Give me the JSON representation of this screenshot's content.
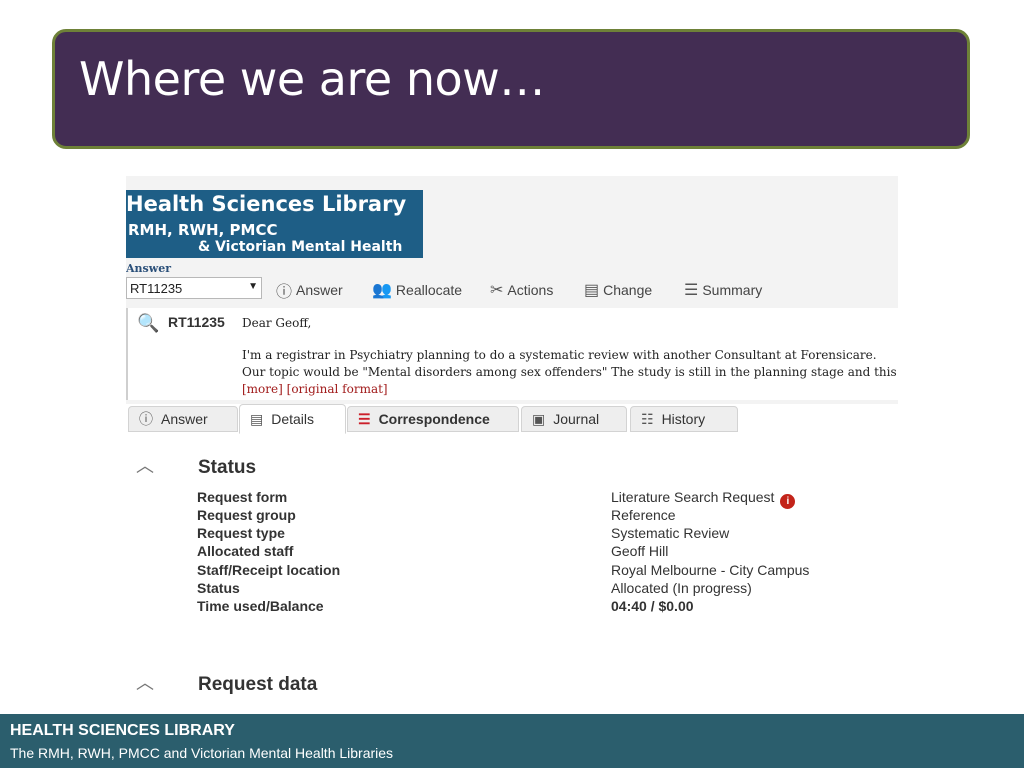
{
  "slide": {
    "title": "Where we are now…",
    "footer_title": "HEALTH SCIENCES LIBRARY",
    "footer_subtitle": "The RMH, RWH, PMCC and Victorian Mental Health Libraries"
  },
  "app": {
    "logo_line1": "Health Sciences Library",
    "logo_line2": "RMH, RWH, PMCC",
    "logo_line3": "& Victorian Mental Health",
    "answer_label": "Answer",
    "request_select": "RT11235",
    "toolbar": {
      "answer": "Answer",
      "reallocate": "Reallocate",
      "actions": "Actions",
      "change": "Change",
      "summary": "Summary"
    },
    "message": {
      "id": "RT11235",
      "greeting": "Dear Geoff,",
      "line1": "I'm a registrar in Psychiatry planning to do a systematic review with another Consultant at Forensicare.",
      "line2": "Our topic would be \"Mental disorders among sex offenders\" The study is still in the planning stage and this",
      "more_link": "[more]",
      "original_link": "[original format]"
    },
    "tabs": [
      "Answer",
      "Details",
      "Correspondence",
      "Journal",
      "History"
    ],
    "status": {
      "heading": "Status",
      "rows": [
        {
          "label": "Request form",
          "value": "Literature Search Request"
        },
        {
          "label": "Request group",
          "value": "Reference"
        },
        {
          "label": "Request type",
          "value": "Systematic Review"
        },
        {
          "label": "Allocated staff",
          "value": "Geoff Hill"
        },
        {
          "label": "Staff/Receipt location",
          "value": "Royal Melbourne - City Campus"
        },
        {
          "label": "Status",
          "value": "Allocated (In progress)"
        },
        {
          "label": "Time used/Balance",
          "value": "04:40 / $0.00"
        }
      ]
    },
    "request_data_heading": "Request data"
  },
  "colors": {
    "title_bg": "#432d53",
    "title_border": "#6e8138",
    "footer_bg": "#2b5e6d",
    "logo_bg": "#1e5e86",
    "link_red": "#a11b1b"
  }
}
